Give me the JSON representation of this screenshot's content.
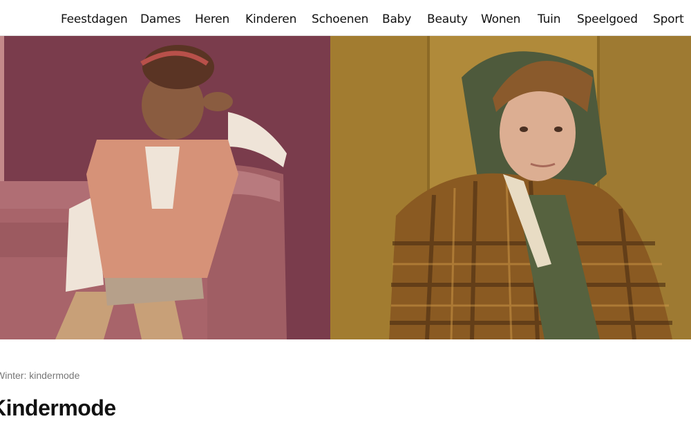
{
  "nav": {
    "items": [
      {
        "label": "Feestdagen"
      },
      {
        "label": "Dames"
      },
      {
        "label": "Heren"
      },
      {
        "label": "Kinderen"
      },
      {
        "label": "Schoenen"
      },
      {
        "label": "Baby"
      },
      {
        "label": "Beauty"
      },
      {
        "label": "Wonen"
      },
      {
        "label": "Tuin"
      },
      {
        "label": "Speelgoed"
      },
      {
        "label": "Sport"
      }
    ]
  },
  "hero": {
    "left_image": "girl-on-sofa-photo",
    "right_image": "boy-in-flannel-jacket-photo"
  },
  "breadcrumb": {
    "current": "Winter: kindermode"
  },
  "page": {
    "title": "Kindermode"
  },
  "colors": {
    "left_background": "#7a3c4c",
    "sofa": "#a8646a",
    "right_background": "#b08a3a",
    "jacket": "#8a5a22",
    "hoodie": "#4e5a3c"
  }
}
